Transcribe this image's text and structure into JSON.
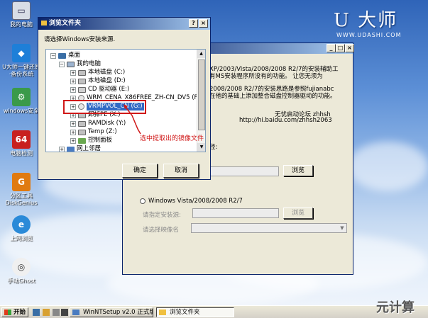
{
  "desktop": {
    "icons": [
      {
        "label": "我的电脑",
        "glyph": "▭"
      },
      {
        "label": "U大师一键还原·备份系统",
        "glyph": "◆"
      },
      {
        "label": "windows安全",
        "glyph": "⚙"
      },
      {
        "label": "电脑检测",
        "glyph": "64"
      },
      {
        "label": "分区工具 DiskGenius",
        "glyph": "G"
      },
      {
        "label": "上网浏览",
        "glyph": "e"
      },
      {
        "label": "手动Ghost",
        "glyph": "◎"
      }
    ]
  },
  "logo": {
    "main": "U 大师",
    "url": "WWW.UDASHI.COM"
  },
  "browse_dialog": {
    "title": "浏览文件夹",
    "prompt": "请选择Windows安装来源.",
    "ok": "确定",
    "cancel": "取消",
    "tree": [
      {
        "label": "桌面",
        "expander": "−",
        "icon": "desktop"
      },
      {
        "label": "我的电脑",
        "expander": "−",
        "icon": "computer"
      },
      {
        "label": "本地磁盘 (C:)",
        "expander": "+",
        "icon": "drive"
      },
      {
        "label": "本地磁盘 (D:)",
        "expander": "+",
        "icon": "drive"
      },
      {
        "label": "CD 驱动器 (E:)",
        "expander": "+",
        "icon": "drive"
      },
      {
        "label": "WRM_CENA_X86FREE_ZH-CN_DV5 (F:)",
        "expander": "+",
        "icon": "cd"
      },
      {
        "label": "VRMPVOL_CN (G:)",
        "expander": "+",
        "icon": "cd",
        "selected": true
      },
      {
        "label": "卸掉PE (X:)",
        "expander": "+",
        "icon": "drive"
      },
      {
        "label": "RAMDisk (Y:)",
        "expander": "+",
        "icon": "drive"
      },
      {
        "label": "Temp (Z:)",
        "expander": "+",
        "icon": "drive"
      },
      {
        "label": "控制面板",
        "expander": "+",
        "icon": "folder"
      },
      {
        "label": "网上邻居",
        "expander": "+",
        "icon": "folder"
      }
    ],
    "annotation": "选中提取出的镜像文件"
  },
  "main_window": {
    "desc_lines": [
      "XP/2003/Vista/2008/2008 R2/7的安装辅助工",
      "有MS安装程序所没有的功能。 让您无须为",
      "2008/2008 R2/7的安装思路是参照fujianabc",
      "在他的基础上添加整合磁盘控制器驱动的功能。"
    ],
    "forum": "无忧启动论坛 zhhsh",
    "link": "http://hi.baidu.com/zhhsh2063",
    "xp_prompt_suffix": "径:",
    "browse1": "浏览",
    "option2": "Windows Vista/2008/2008 R2/7",
    "install_source_label": "请指定安装源:",
    "browse2": "浏览",
    "image_name_label": "请选择映像名"
  },
  "taskbar": {
    "start": "开始",
    "items": [
      "WinNTSetup v2.0 正式版",
      "浏览文件夹"
    ]
  },
  "watermark": "元计算"
}
